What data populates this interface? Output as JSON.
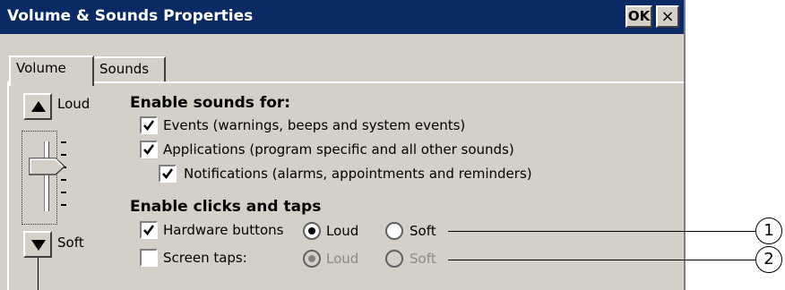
{
  "window": {
    "title": "Volume & Sounds Properties",
    "ok_label": "OK",
    "close_symbol": "×"
  },
  "tabs": [
    {
      "label": "Volume",
      "active": true
    },
    {
      "label": "Sounds",
      "active": false
    }
  ],
  "volume": {
    "loud_label": "Loud",
    "soft_label": "Soft",
    "level": 0.75
  },
  "sounds": {
    "heading": "Enable sounds for:",
    "events_label": "Events (warnings, beeps and system events)",
    "events_checked": true,
    "applications_label": "Applications (program specific and all other sounds)",
    "applications_checked": true,
    "notifications_label": "Notifications (alarms, appointments and reminders)",
    "notifications_checked": true
  },
  "clicks": {
    "heading": "Enable clicks and taps",
    "hardware_label": "Hardware buttons",
    "hardware_checked": true,
    "hardware_loud": "Loud",
    "hardware_soft": "Soft",
    "hardware_selected": "Loud",
    "screen_label": "Screen taps:",
    "screen_checked": false,
    "screen_loud": "Loud",
    "screen_soft": "Soft"
  },
  "callouts": [
    "1",
    "2"
  ],
  "colors": {
    "titlebar": "#0a2a66",
    "face": "#d4d0c8"
  }
}
